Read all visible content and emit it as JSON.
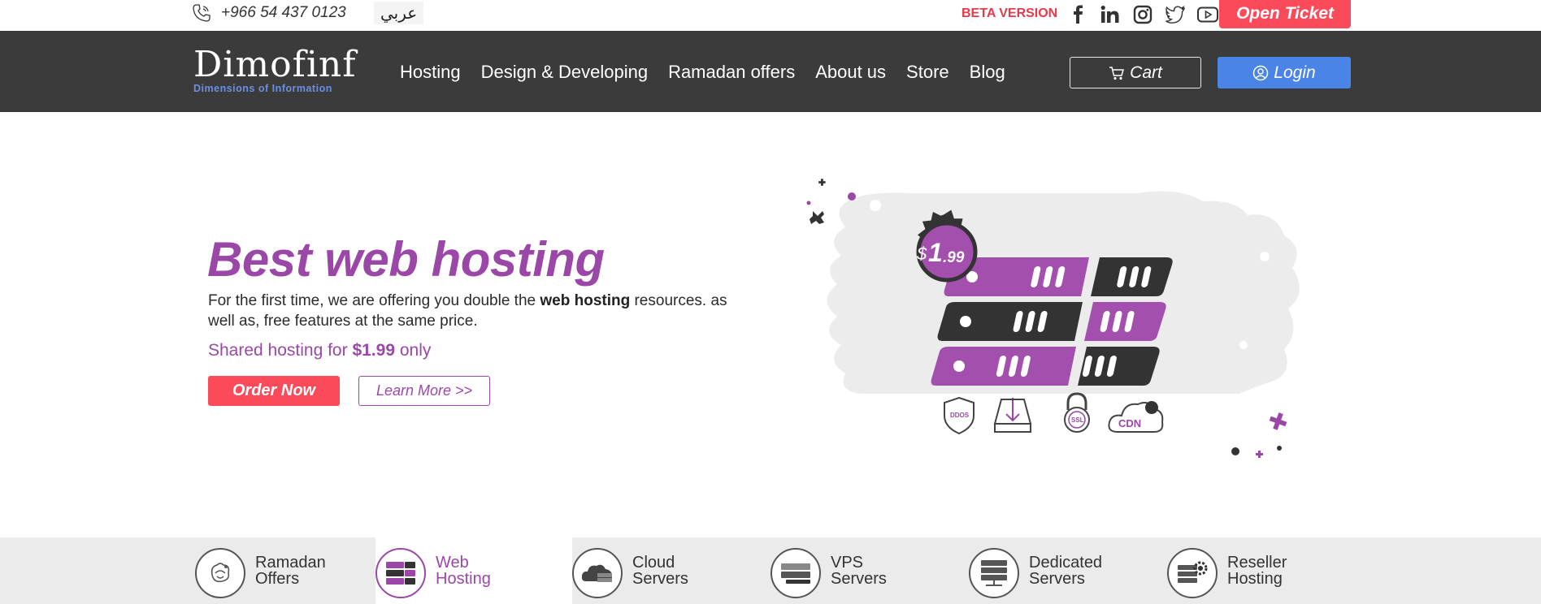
{
  "topbar": {
    "phone": "+966 54 437 0123",
    "language": "عربي",
    "beta": "BETA VERSION",
    "open_ticket": "Open Ticket",
    "socials": [
      "facebook-icon",
      "linkedin-icon",
      "instagram-icon",
      "twitter-icon",
      "youtube-icon"
    ]
  },
  "nav": {
    "logo_text": "Dimofinf",
    "logo_sub": "Dimensions of Information",
    "menu": [
      "Hosting",
      "Design & Developing",
      "Ramadan offers",
      "About us",
      "Store",
      "Blog"
    ],
    "cart": "Cart",
    "login": "Login"
  },
  "hero": {
    "title": "Best web hosting",
    "desc_pre": "For the first time, we are offering you double the ",
    "desc_bold": "web hosting",
    "desc_post": " resources. as well as, free features at the same price.",
    "price_pre": "Shared hosting for ",
    "price_value": "$1.99",
    "price_post": " only",
    "order_button": "Order Now",
    "learn_button": "Learn More >>",
    "badge_dollar": "$",
    "badge_main": "1",
    "badge_cents": ".99",
    "features": [
      "DDOS",
      "SSL",
      "CDN"
    ]
  },
  "tabs": [
    {
      "label_1": "Ramadan",
      "label_2": "Offers",
      "active": false
    },
    {
      "label_1": "Web",
      "label_2": "Hosting",
      "active": true
    },
    {
      "label_1": "Cloud",
      "label_2": "Servers",
      "active": false
    },
    {
      "label_1": "VPS",
      "label_2": "Servers",
      "active": false
    },
    {
      "label_1": "Dedicated",
      "label_2": "Servers",
      "active": false
    },
    {
      "label_1": "Reseller",
      "label_2": "Hosting",
      "active": false
    }
  ],
  "colors": {
    "accent": "#9a47a8",
    "red": "#fb4b5a",
    "nav_bg": "#3b3b3b",
    "login_blue": "#4a84e6"
  }
}
